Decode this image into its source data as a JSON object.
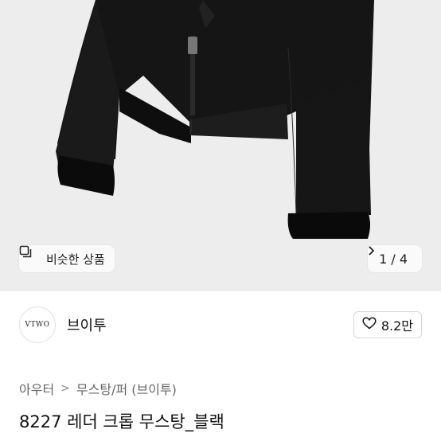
{
  "similar": {
    "label": "비슷한 상품",
    "icon": "similar-items-icon"
  },
  "pager": {
    "text": "1 / 4",
    "icon": "chevron-right-icon"
  },
  "seller": {
    "avatar_text": "VTWO",
    "name": "브이투"
  },
  "like": {
    "count": "8.2만",
    "icon": "heart-outline-icon"
  },
  "breadcrumb": {
    "items": [
      "아우터",
      "무스탕/퍼 (브이투)"
    ],
    "separator": ">"
  },
  "product": {
    "title": "8227 레더 크롭 무스탕_블랙"
  },
  "colors": {
    "hero_bg": "#ededed",
    "jacket": "#151515",
    "shearling": "#0b0b0b"
  }
}
